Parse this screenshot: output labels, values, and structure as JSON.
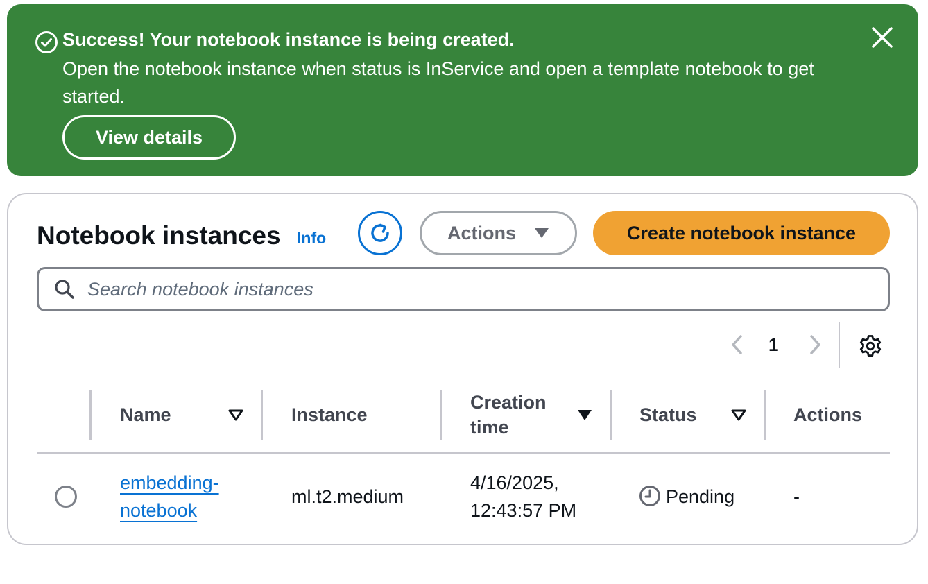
{
  "flash": {
    "title": "Success! Your notebook instance is being created.",
    "body": "Open the notebook instance when status is InService and open a template notebook to get started.",
    "button_label": "View details",
    "icon": "check-circle-icon",
    "close_icon": "close-icon",
    "color": "#37843b"
  },
  "header": {
    "title": "Notebook instances",
    "info_label": "Info",
    "refresh_icon": "refresh-icon",
    "actions_label": "Actions",
    "create_label": "Create notebook instance",
    "create_color": "#f0a233"
  },
  "search": {
    "placeholder": "Search notebook instances",
    "value": ""
  },
  "pagination": {
    "current_page": "1"
  },
  "table": {
    "columns": [
      {
        "label": "Name",
        "sort": "unsorted"
      },
      {
        "label": "Instance"
      },
      {
        "label": "Creation time",
        "sort": "descending"
      },
      {
        "label": "Status",
        "sort": "unsorted"
      },
      {
        "label": "Actions"
      }
    ],
    "rows": [
      {
        "selected": false,
        "name": "embedding-notebook",
        "instance": "ml.t2.medium",
        "creation_time": "4/16/2025, 12:43:57 PM",
        "status": "Pending",
        "status_icon": "clock-icon",
        "actions": "-"
      }
    ]
  }
}
